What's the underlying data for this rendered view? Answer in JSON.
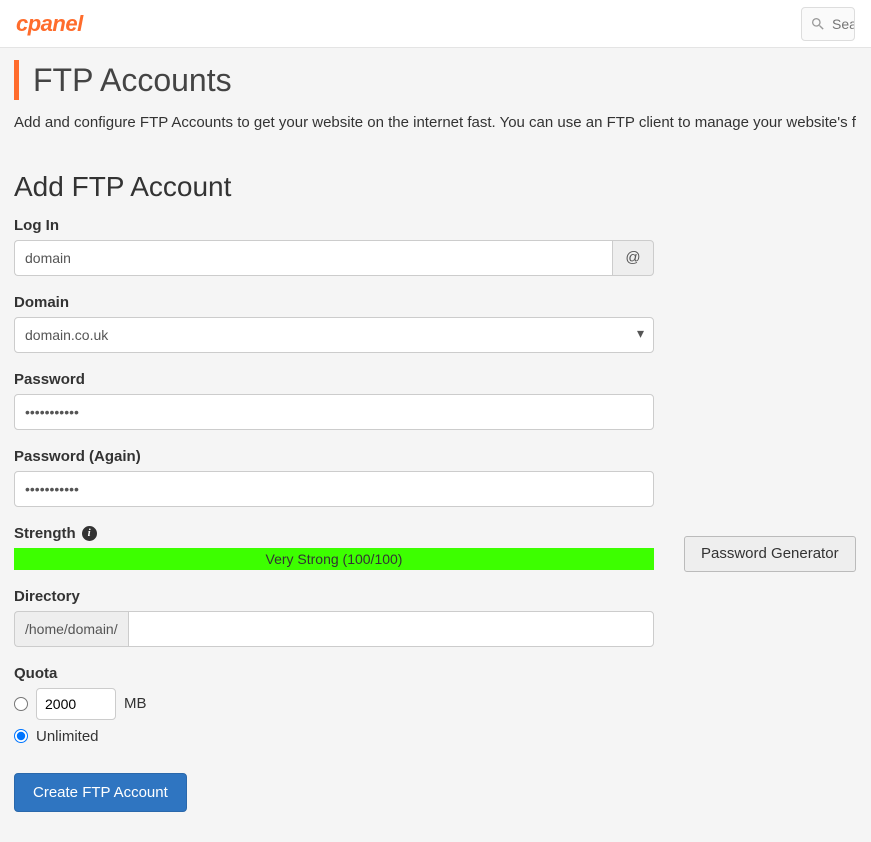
{
  "topbar": {
    "logo_text": "cPanel",
    "search_placeholder": "Sea"
  },
  "page": {
    "title": "FTP Accounts",
    "description": "Add and configure FTP Accounts to get your website on the internet fast. You can use an FTP client to manage your website's files. Fo"
  },
  "form": {
    "section_title": "Add FTP Account",
    "login": {
      "label": "Log In",
      "value": "domain",
      "at_symbol": "@"
    },
    "domain": {
      "label": "Domain",
      "value": "domain.co.uk"
    },
    "password": {
      "label": "Password",
      "value": "•••••••••••"
    },
    "password_again": {
      "label": "Password (Again)",
      "value": "•••••••••••"
    },
    "strength": {
      "label": "Strength",
      "bar_text": "Very Strong (100/100)",
      "generator_btn": "Password Generator"
    },
    "directory": {
      "label": "Directory",
      "prefix": "/home/domain/",
      "value": ""
    },
    "quota": {
      "label": "Quota",
      "size_value": "2000",
      "size_unit": "MB",
      "unlimited_label": "Unlimited",
      "selected": "unlimited"
    },
    "submit_label": "Create FTP Account"
  }
}
